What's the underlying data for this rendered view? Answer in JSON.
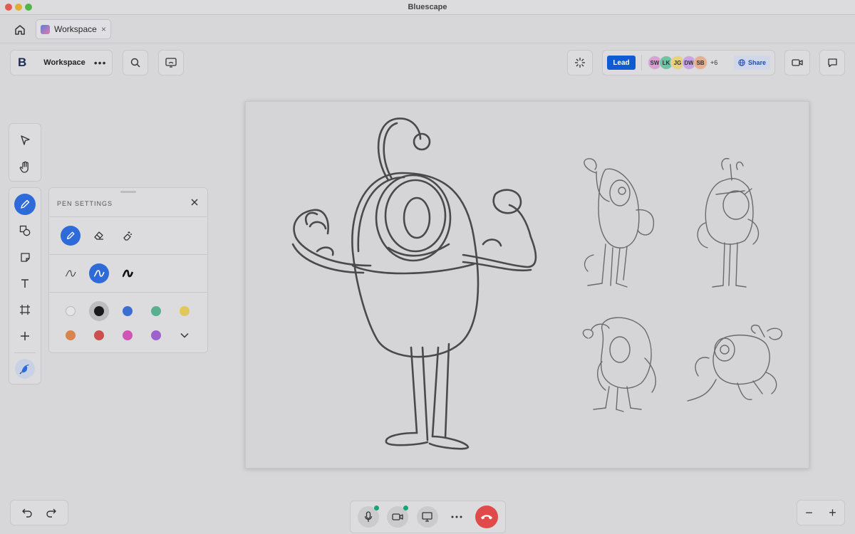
{
  "window": {
    "title": "Bluescape"
  },
  "tab": {
    "label": "Workspace",
    "close": "×"
  },
  "toolbar": {
    "logo": "B",
    "workspace_name": "Workspace",
    "more": "•••"
  },
  "collab": {
    "lead_label": "Lead",
    "avatars": [
      {
        "initials": "SW",
        "color": "#d9a0d6"
      },
      {
        "initials": "LK",
        "color": "#6fc2a3"
      },
      {
        "initials": "JG",
        "color": "#e8d27a"
      },
      {
        "initials": "DW",
        "color": "#c9a3e6"
      },
      {
        "initials": "SB",
        "color": "#e6b090"
      }
    ],
    "more_count": "+6",
    "share_label": "Share"
  },
  "pen_settings": {
    "title": "PEN SETTINGS",
    "colors": [
      {
        "name": "white",
        "hex": "#e4e4e6"
      },
      {
        "name": "black",
        "hex": "#1a1a1a",
        "selected": true
      },
      {
        "name": "blue",
        "hex": "#3a6fd0"
      },
      {
        "name": "green",
        "hex": "#59b090"
      },
      {
        "name": "yellow",
        "hex": "#e2c85a"
      },
      {
        "name": "orange",
        "hex": "#d8844f"
      },
      {
        "name": "red",
        "hex": "#cc5050"
      },
      {
        "name": "pink",
        "hex": "#cf56b6"
      },
      {
        "name": "purple",
        "hex": "#9e62cf"
      }
    ]
  },
  "colors": {
    "accent": "#2f6ad9",
    "lead": "#0f5bd1",
    "hangup": "#e14a4a",
    "live": "#1aa37a"
  },
  "zoom": {
    "minus": "−",
    "plus": "+"
  }
}
